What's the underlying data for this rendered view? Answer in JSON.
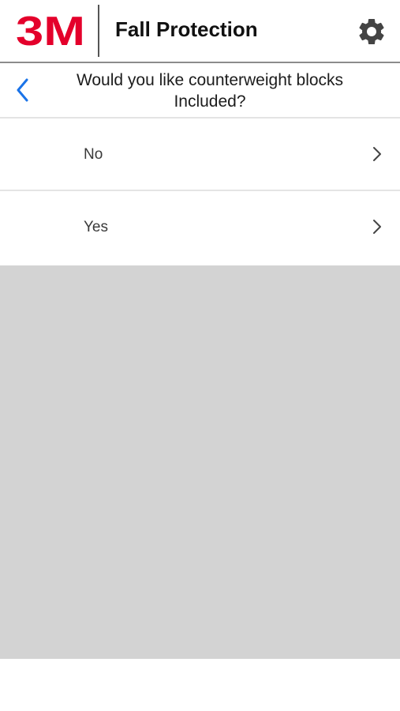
{
  "header": {
    "logo_text": "3M",
    "title": "Fall Protection",
    "settings_icon": "gear-icon",
    "brand_color": "#e4002b"
  },
  "question": {
    "back_icon": "chevron-left-icon",
    "text": "Would you like counterweight blocks Included?",
    "accent_color": "#1a73e8"
  },
  "options": [
    {
      "label": "No",
      "icon": "chevron-right-icon"
    },
    {
      "label": "Yes",
      "icon": "chevron-right-icon"
    }
  ]
}
